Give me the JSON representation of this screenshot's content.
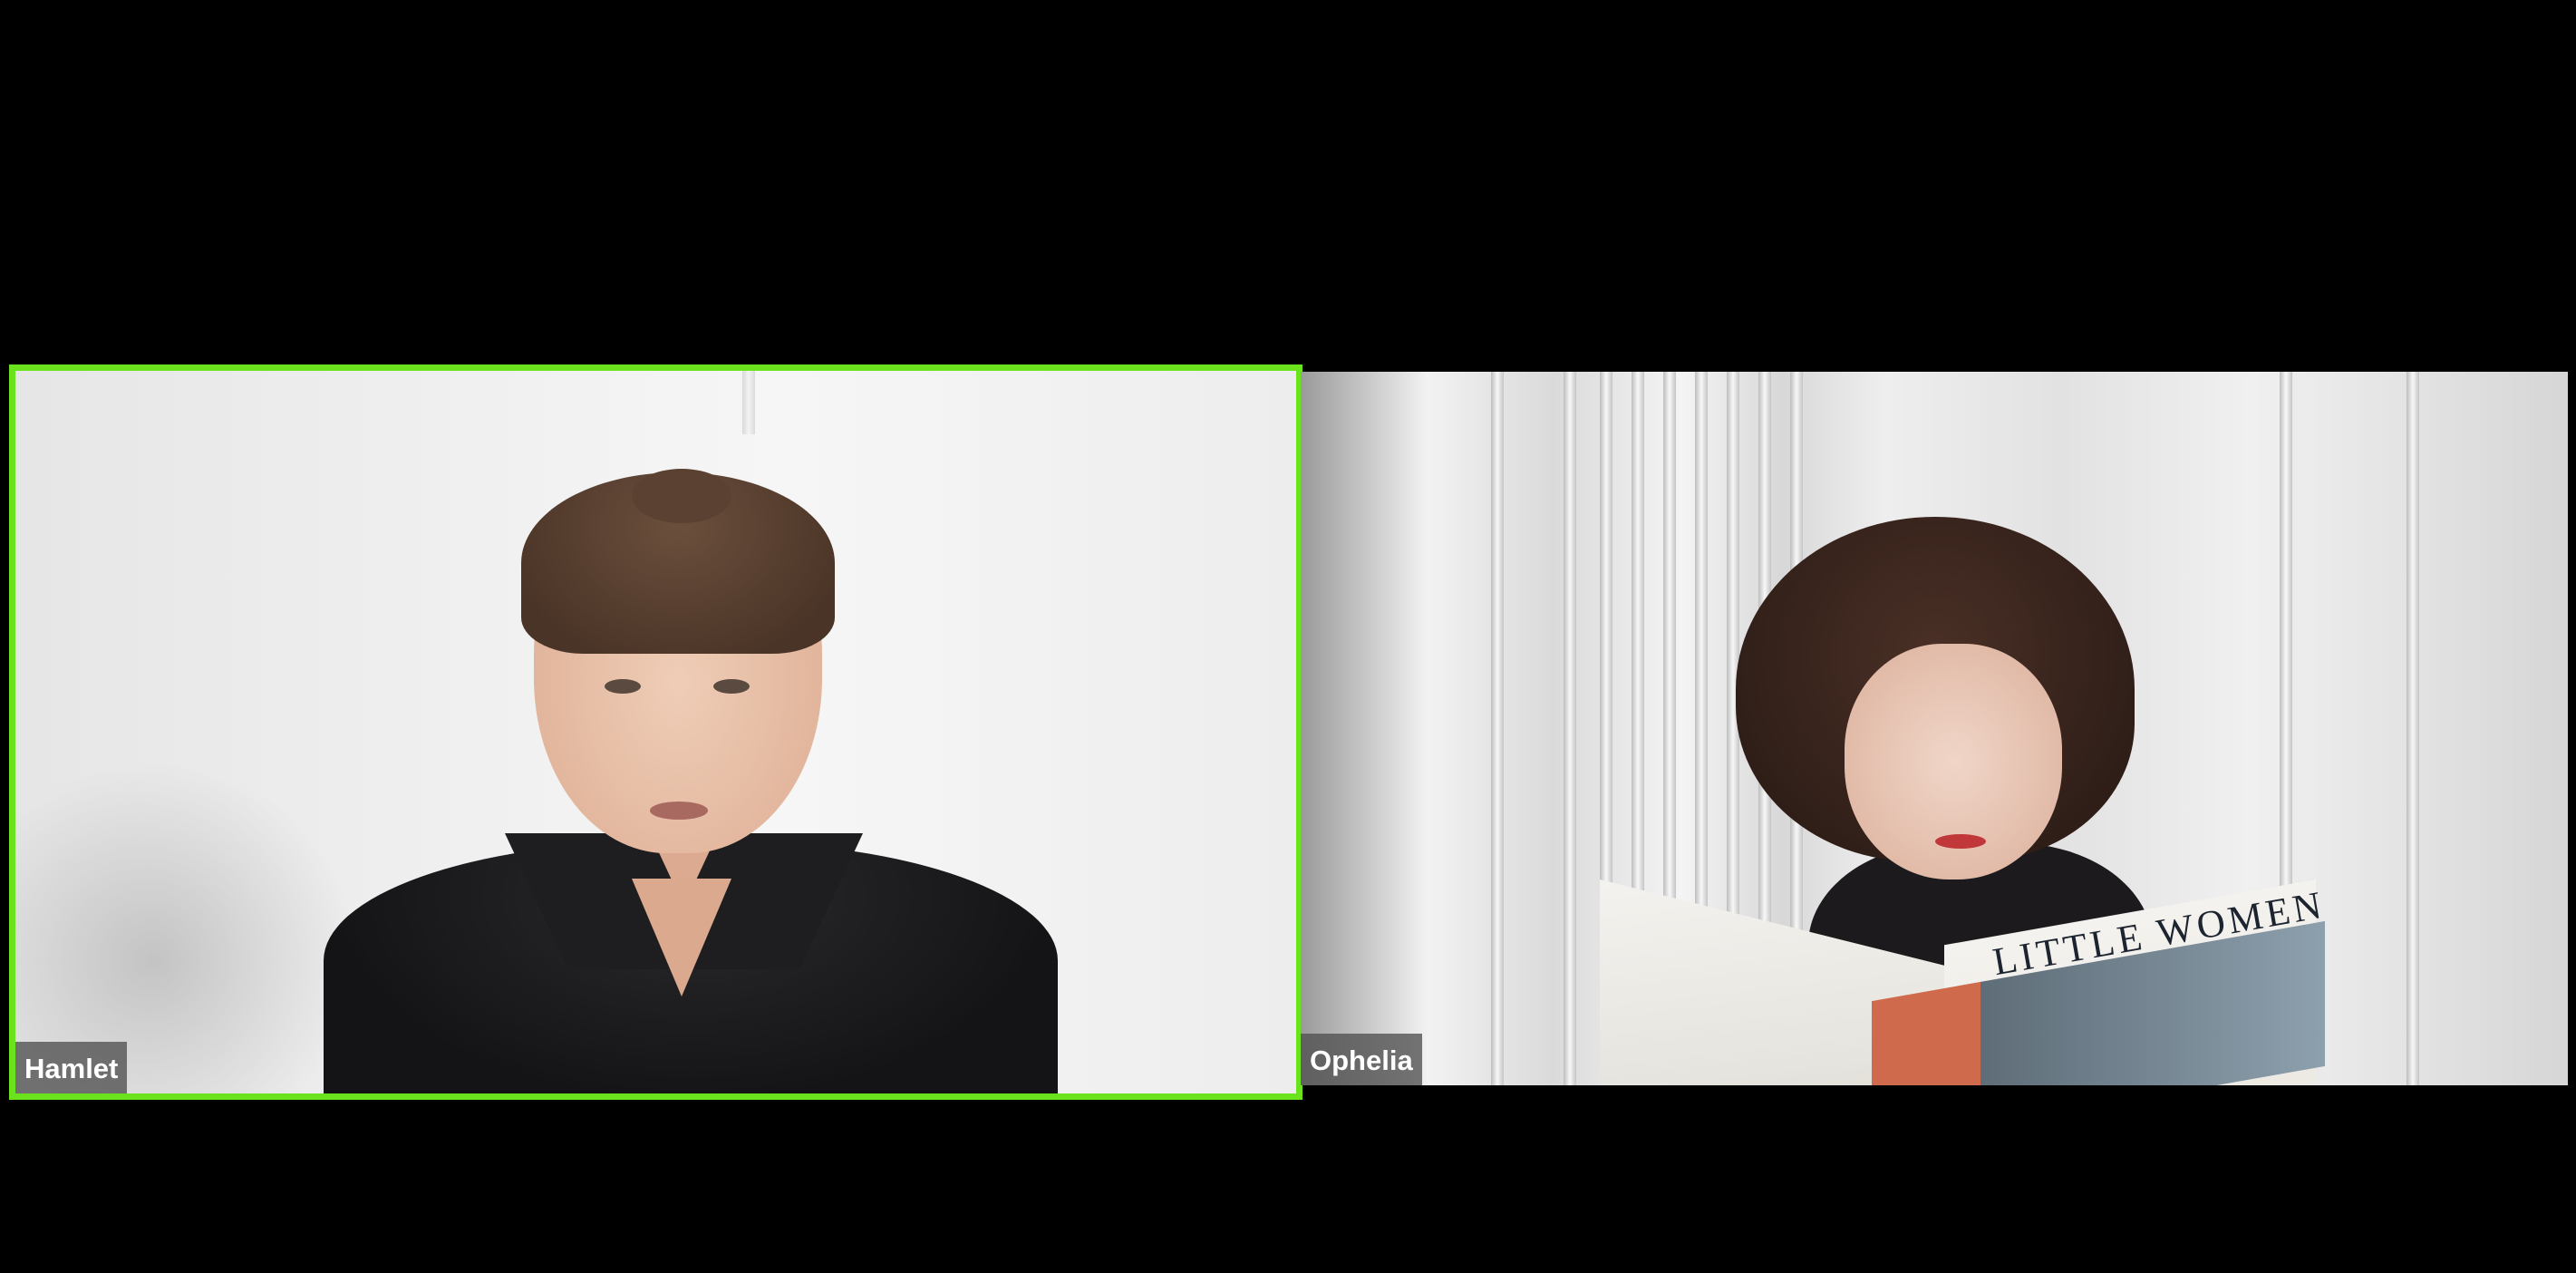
{
  "participants": [
    {
      "name": "Hamlet",
      "active_speaker": true
    },
    {
      "name": "Ophelia",
      "active_speaker": false
    }
  ],
  "book_title": "LITTLE WOMEN",
  "colors": {
    "background": "#000000",
    "active_speaker_border": "#6ae21c",
    "name_tag_bg": "#505050",
    "name_tag_text": "#ffffff"
  }
}
